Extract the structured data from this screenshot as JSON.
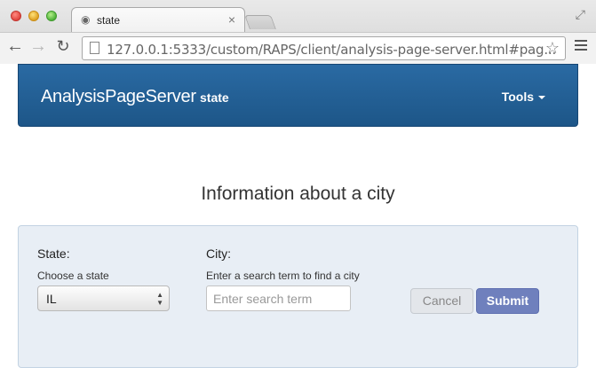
{
  "browser": {
    "tab_title": "state",
    "url": "127.0.0.1:5333/custom/RAPS/client/analysis-page-server.html#pag..."
  },
  "navbar": {
    "brand": "AnalysisPageServer",
    "subtitle": "state",
    "tools_label": "Tools"
  },
  "page": {
    "title": "Information about a city"
  },
  "form": {
    "state_label": "State:",
    "state_help": "Choose a state",
    "state_value": "IL",
    "city_label": "City:",
    "city_help": "Enter a search term to find a city",
    "city_placeholder": "Enter search term",
    "cancel_label": "Cancel",
    "submit_label": "Submit"
  },
  "colors": {
    "navbar": "#1f5a8e",
    "panel_bg": "#e8eef5",
    "submit": "#6f80bd"
  },
  "icons": [
    "close-window-icon",
    "minimize-window-icon",
    "maximize-window-icon",
    "favicon-icon",
    "tab-close-icon",
    "back-arrow-icon",
    "forward-arrow-icon",
    "reload-icon",
    "page-icon",
    "bookmark-star-icon",
    "menu-icon",
    "fullscreen-icon",
    "caret-down-icon"
  ]
}
